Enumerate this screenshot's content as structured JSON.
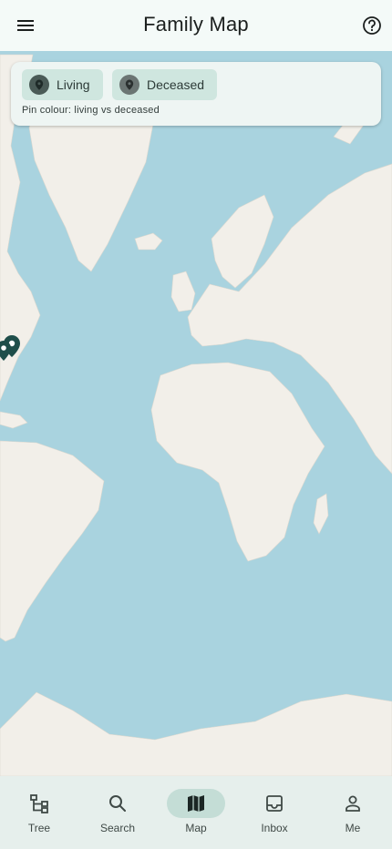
{
  "app_bar": {
    "title": "Family Map",
    "menu_icon": "menu-icon",
    "help_icon": "help-circle-icon"
  },
  "legend": {
    "chips": [
      {
        "label": "Living",
        "color": "#4a5b57",
        "icon": "map-pin-icon"
      },
      {
        "label": "Deceased",
        "color": "#6b7573",
        "icon": "map-pin-icon"
      }
    ],
    "note": "Pin colour: living vs deceased"
  },
  "map": {
    "ocean_color": "#a9d3df",
    "land_color": "#f2efe9",
    "pin_color": "#1f4e4a",
    "pin_count": 2
  },
  "bottom_nav": {
    "active_color": "#c4ddd6",
    "items": [
      {
        "label": "Tree",
        "icon": "tree-icon",
        "active": false
      },
      {
        "label": "Search",
        "icon": "search-icon",
        "active": false
      },
      {
        "label": "Map",
        "icon": "map-icon",
        "active": true
      },
      {
        "label": "Inbox",
        "icon": "inbox-icon",
        "active": false
      },
      {
        "label": "Me",
        "icon": "person-icon",
        "active": false
      }
    ]
  }
}
